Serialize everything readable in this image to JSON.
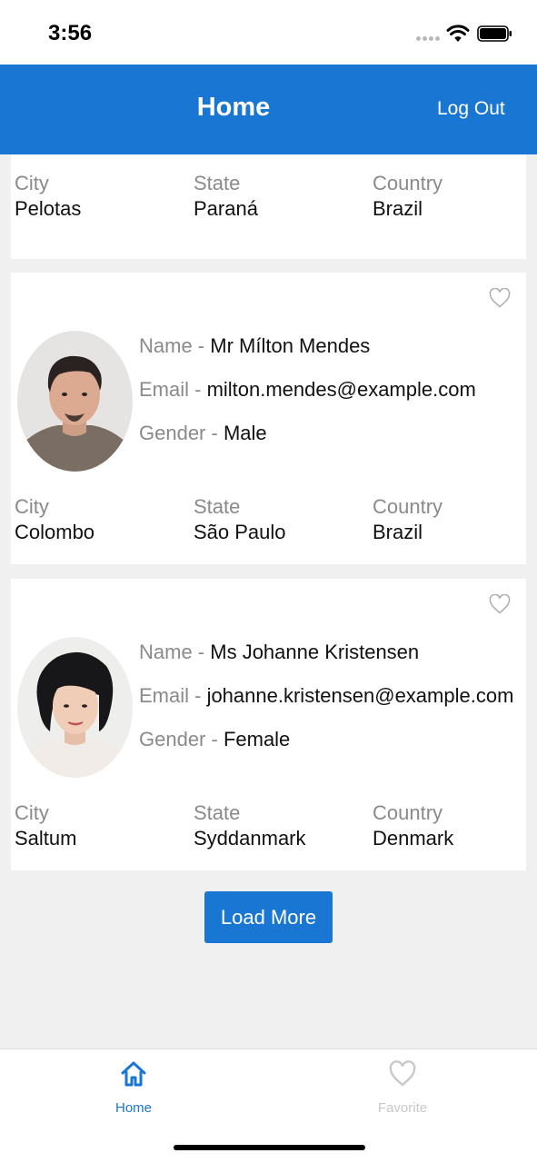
{
  "status": {
    "time": "3:56"
  },
  "header": {
    "title": "Home",
    "logout_label": "Log Out"
  },
  "labels": {
    "name": "Name - ",
    "email": "Email - ",
    "gender": "Gender - ",
    "city": "City",
    "state": "State",
    "country": "Country"
  },
  "users": [
    {
      "city": "Pelotas",
      "state": "Paraná",
      "country": "Brazil"
    },
    {
      "name": "Mr Mílton Mendes",
      "email": "milton.mendes@example.com",
      "gender": "Male",
      "city": "Colombo",
      "state": "São Paulo",
      "country": "Brazil"
    },
    {
      "name": "Ms Johanne Kristensen",
      "email": "johanne.kristensen@example.com",
      "gender": "Female",
      "city": "Saltum",
      "state": "Syddanmark",
      "country": "Denmark"
    }
  ],
  "load_more_label": "Load More",
  "tabs": [
    {
      "label": "Home",
      "icon": "home-icon",
      "active": true
    },
    {
      "label": "Favorite",
      "icon": "heart-icon",
      "active": false
    }
  ],
  "colors": {
    "primary": "#1976d2",
    "active_tab": "#1976d2",
    "inactive_tab": "#c8c8c8"
  }
}
